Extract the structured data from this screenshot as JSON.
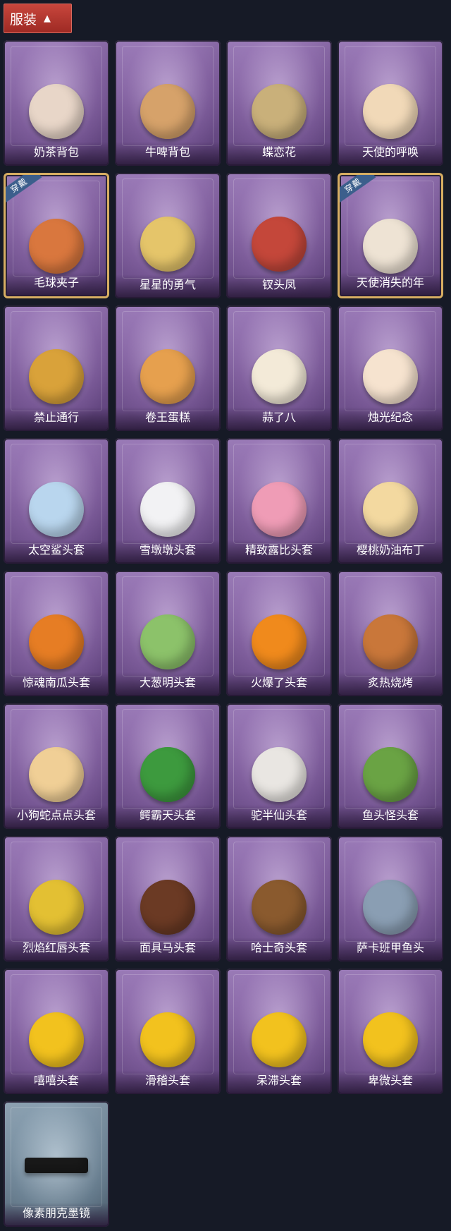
{
  "header": {
    "title": "服装",
    "caret": "▲"
  },
  "badge_text": "穿戴",
  "items": [
    {
      "label": "奶茶背包",
      "icon": "milk-tea-backpack-icon",
      "color": "#e8d6c8",
      "equipped": false
    },
    {
      "label": "牛啤背包",
      "icon": "cow-beer-backpack-icon",
      "color": "#d6a26a",
      "equipped": false
    },
    {
      "label": "蝶恋花",
      "icon": "butterfly-flower-icon",
      "color": "#c9b07a",
      "equipped": false
    },
    {
      "label": "天使的呼唤",
      "icon": "angel-call-icon",
      "color": "#f1d9b8",
      "equipped": false
    },
    {
      "label": "毛球夹子",
      "icon": "fur-ball-clip-icon",
      "color": "#d9773e",
      "equipped": true
    },
    {
      "label": "星星的勇气",
      "icon": "star-courage-icon",
      "color": "#e5c56a",
      "equipped": false
    },
    {
      "label": "钗头凤",
      "icon": "phoenix-hairpin-icon",
      "color": "#c4473a",
      "equipped": false
    },
    {
      "label": "天使消失的年",
      "icon": "angel-vanished-icon",
      "color": "#eee3d4",
      "equipped": true
    },
    {
      "label": "禁止通行",
      "icon": "no-entry-icon",
      "color": "#d9a23a",
      "equipped": false
    },
    {
      "label": "卷王蛋糕",
      "icon": "roll-cake-icon",
      "color": "#e6a04e",
      "equipped": false
    },
    {
      "label": "蒜了八",
      "icon": "garlic-icon",
      "color": "#f3ead8",
      "equipped": false
    },
    {
      "label": "烛光纪念",
      "icon": "candle-icon",
      "color": "#f6e3cf",
      "equipped": false
    },
    {
      "label": "太空鲨头套",
      "icon": "space-shark-icon",
      "color": "#b9d6ee",
      "equipped": false
    },
    {
      "label": "雪墩墩头套",
      "icon": "snowman-icon",
      "color": "#f2f2f4",
      "equipped": false
    },
    {
      "label": "精致露比头套",
      "icon": "loopy-icon",
      "color": "#ef9cb6",
      "equipped": false
    },
    {
      "label": "樱桃奶油布丁",
      "icon": "pudding-icon",
      "color": "#f3d9a0",
      "equipped": false
    },
    {
      "label": "惊魂南瓜头套",
      "icon": "pumpkin-icon",
      "color": "#e67d24",
      "equipped": false
    },
    {
      "label": "大葱明头套",
      "icon": "scallion-icon",
      "color": "#8cc26a",
      "equipped": false
    },
    {
      "label": "火爆了头套",
      "icon": "fire-icon",
      "color": "#f08a1c",
      "equipped": false
    },
    {
      "label": "炙热烧烤",
      "icon": "bbq-icon",
      "color": "#c9773a",
      "equipped": false
    },
    {
      "label": "小狗蛇点点头套",
      "icon": "dog-snake-icon",
      "color": "#f0cf96",
      "equipped": false
    },
    {
      "label": "鳄霸天头套",
      "icon": "crocodile-icon",
      "color": "#3d9a3e",
      "equipped": false
    },
    {
      "label": "驼半仙头套",
      "icon": "bear-icon",
      "color": "#e9e6e2",
      "equipped": false
    },
    {
      "label": "鱼头怪头套",
      "icon": "fish-head-icon",
      "color": "#6aa344",
      "equipped": false
    },
    {
      "label": "烈焰红唇头套",
      "icon": "red-lips-icon",
      "color": "#e3c033",
      "equipped": false
    },
    {
      "label": "面具马头套",
      "icon": "horse-mask-icon",
      "color": "#6b3a24",
      "equipped": false
    },
    {
      "label": "哈士奇头套",
      "icon": "husky-icon",
      "color": "#8a5a2e",
      "equipped": false
    },
    {
      "label": "萨卡班甲鱼头",
      "icon": "sacabambaspis-icon",
      "color": "#8a9eb3",
      "equipped": false
    },
    {
      "label": "嘻嘻头套",
      "icon": "grin-emoji-icon",
      "color": "#f2c21e",
      "equipped": false
    },
    {
      "label": "滑稽头套",
      "icon": "funny-emoji-icon",
      "color": "#f2c21e",
      "equipped": false
    },
    {
      "label": "呆滞头套",
      "icon": "dazed-emoji-icon",
      "color": "#f2c21e",
      "equipped": false
    },
    {
      "label": "卑微头套",
      "icon": "humble-emoji-icon",
      "color": "#f2c21e",
      "equipped": false
    },
    {
      "label": "像素朋克墨镜",
      "icon": "pixel-sunglasses-icon",
      "color": "#1a1a1a",
      "equipped": false,
      "special": true
    }
  ]
}
